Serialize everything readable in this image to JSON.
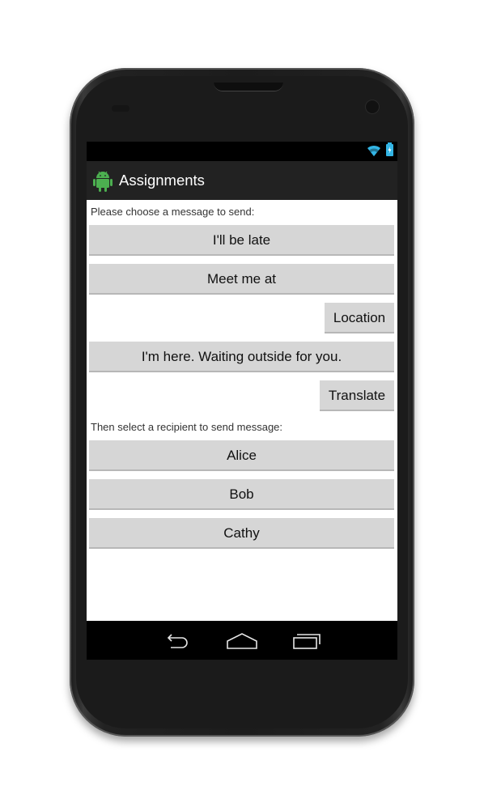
{
  "app": {
    "title": "Assignments"
  },
  "messages_label": "Please choose a message to send:",
  "messages": {
    "late": "I'll be late",
    "meet": "Meet me at",
    "location": "Location",
    "here": "I'm here. Waiting outside for you.",
    "translate": "Translate"
  },
  "recipients_label": "Then select a recipient to send message:",
  "recipients": [
    "Alice",
    "Bob",
    "Cathy"
  ],
  "colors": {
    "actionbar": "#222222",
    "statusbar": "#000000",
    "button": "#d6d6d6",
    "android_green": "#4caf50",
    "status_blue": "#33b5e5"
  },
  "icons": {
    "wifi": "wifi-icon",
    "battery": "battery-icon",
    "app": "android-icon",
    "back": "back-icon",
    "home": "home-icon",
    "recents": "recents-icon"
  }
}
